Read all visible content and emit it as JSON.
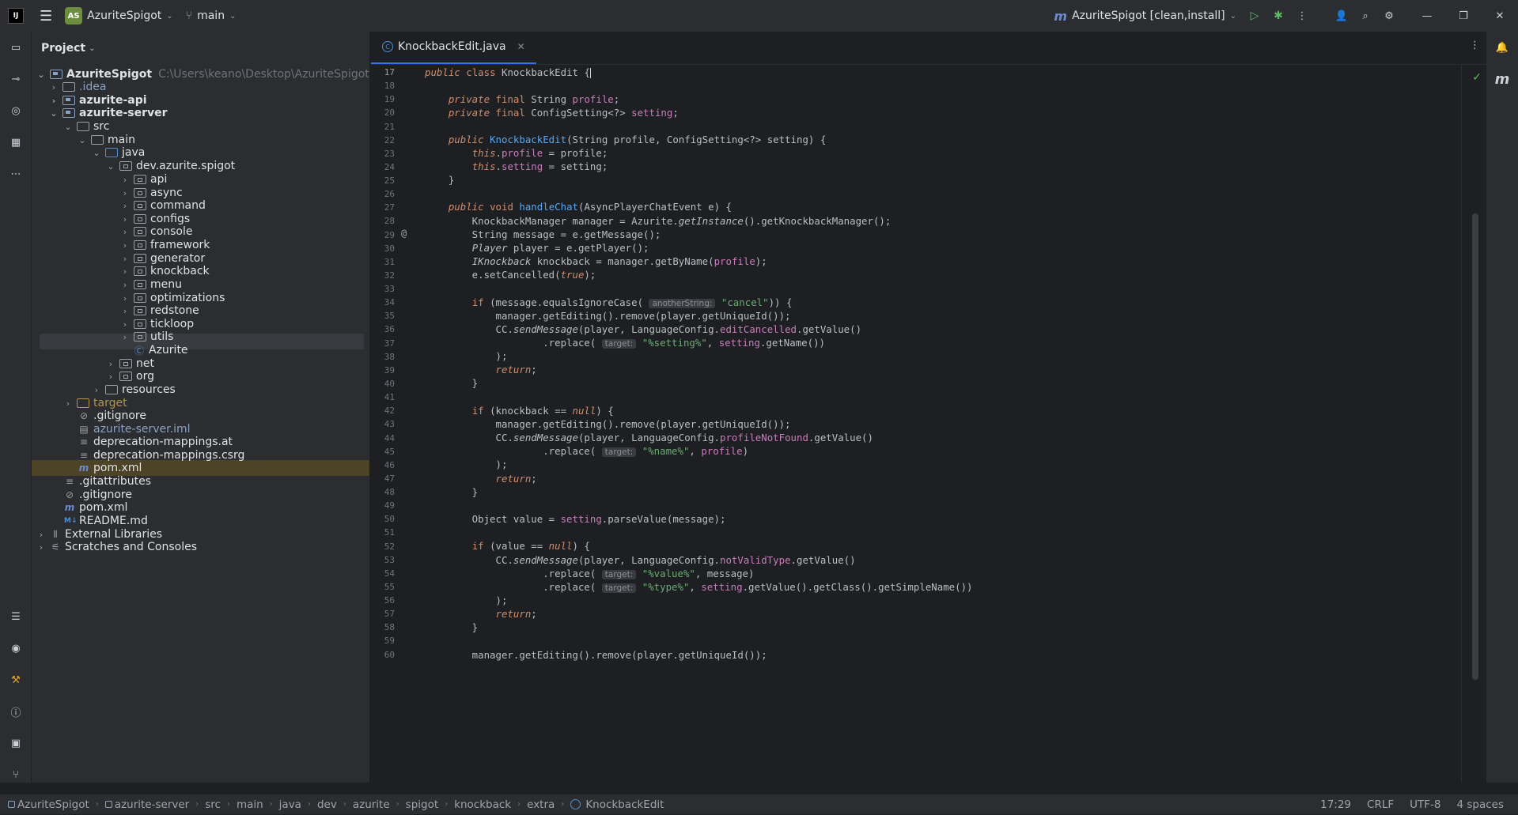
{
  "titlebar": {
    "project_initials": "AS",
    "project_name": "AzuriteSpigot",
    "branch": "main",
    "run_config": "AzuriteSpigot [clean,install]"
  },
  "project_panel": {
    "title": "Project",
    "tree": [
      {
        "label": "AzuriteSpigot",
        "path": "C:\\Users\\keano\\Desktop\\AzuriteSpigot"
      },
      {
        "label": ".idea"
      },
      {
        "label": "azurite-api"
      },
      {
        "label": "azurite-server"
      },
      {
        "label": "src"
      },
      {
        "label": "main"
      },
      {
        "label": "java"
      },
      {
        "label": "dev.azurite.spigot"
      },
      {
        "label": "api"
      },
      {
        "label": "async"
      },
      {
        "label": "command"
      },
      {
        "label": "configs"
      },
      {
        "label": "console"
      },
      {
        "label": "framework"
      },
      {
        "label": "generator"
      },
      {
        "label": "knockback"
      },
      {
        "label": "menu"
      },
      {
        "label": "optimizations"
      },
      {
        "label": "redstone"
      },
      {
        "label": "tickloop"
      },
      {
        "label": "utils"
      },
      {
        "label": "Azurite"
      },
      {
        "label": "net"
      },
      {
        "label": "org"
      },
      {
        "label": "resources"
      },
      {
        "label": "target"
      },
      {
        "label": ".gitignore"
      },
      {
        "label": "azurite-server.iml"
      },
      {
        "label": "deprecation-mappings.at"
      },
      {
        "label": "deprecation-mappings.csrg"
      },
      {
        "label": "pom.xml"
      },
      {
        "label": ".gitattributes"
      },
      {
        "label": ".gitignore"
      },
      {
        "label": "pom.xml"
      },
      {
        "label": "README.md"
      },
      {
        "label": "External Libraries"
      },
      {
        "label": "Scratches and Consoles"
      }
    ]
  },
  "editor": {
    "tab_label": "KnockbackEdit.java",
    "line_numbers": [
      "17",
      "18",
      "19",
      "20",
      "21",
      "22",
      "23",
      "24",
      "25",
      "26",
      "27",
      "28",
      "29",
      "30",
      "31",
      "32",
      "33",
      "34",
      "35",
      "36",
      "37",
      "38",
      "39",
      "40",
      "41",
      "42",
      "43",
      "44",
      "45",
      "46",
      "47",
      "48",
      "49",
      "50",
      "51",
      "52",
      "53",
      "54",
      "55",
      "56",
      "57",
      "58",
      "59",
      "60"
    ],
    "hints": {
      "anotherString": "anotherString:",
      "target": "target:"
    }
  },
  "statusbar": {
    "breadcrumbs": [
      "AzuriteSpigot",
      "azurite-server",
      "src",
      "main",
      "java",
      "dev",
      "azurite",
      "spigot",
      "knockback",
      "extra",
      "KnockbackEdit"
    ],
    "position": "17:29",
    "line_sep": "CRLF",
    "encoding": "UTF-8",
    "indent": "4 spaces"
  },
  "colors": {
    "background": "#1e1f22",
    "panel": "#2b2d30",
    "accent": "#3574f0",
    "keyword": "#cf8e6d",
    "field": "#c77dbb",
    "method": "#56a8f5",
    "string": "#6aab73"
  }
}
